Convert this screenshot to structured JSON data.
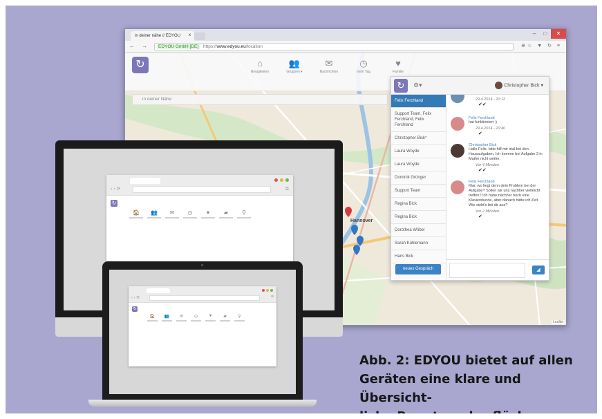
{
  "browser": {
    "tab_title": "in deiner nähe // EDYOU",
    "tab_close": "x",
    "certificate": "EDYOU GmbH [DE]",
    "url_prefix": "https://",
    "url_main": "www.edyou.eu",
    "url_path": "/location",
    "nav_glyphs": "← → C",
    "toolbar_glyphs": "⊕☆ ▼ ↻ ≡",
    "window_controls": [
      "–",
      "□",
      "✕"
    ]
  },
  "app": {
    "logo_glyph": "↻",
    "nav": [
      {
        "label": "Neuigkeiten",
        "icon": "⌂"
      },
      {
        "label": "Gruppen ▾",
        "icon": "👥"
      },
      {
        "label": "Nachrichten",
        "icon": "✉"
      },
      {
        "label": "mein Tag",
        "icon": "◷"
      },
      {
        "label": "Familie",
        "icon": "♥"
      }
    ],
    "breadcrumb": "in deiner Nähe",
    "map_label": "Hannover",
    "map_attribution": "Leaflet"
  },
  "chat": {
    "user_name": "Christopher Bick ▾",
    "gear": "⚙▾",
    "contacts": [
      "Felix Ferchland",
      "Support Team, Felix Ferchland, Felix Ferchland",
      "Christopher Bick*",
      "Laura Woyde",
      "Laura Woyde",
      "Dominik Grünger",
      "Support Team",
      "Regina Bick",
      "Regina Bick",
      "Dorothea Wöbel",
      "Sarah Kühlemann",
      "Hans Bick"
    ],
    "new_chat_button": "neues Gespräch",
    "send_icon": "◢",
    "messages": [
      {
        "name": "",
        "text": "",
        "time": "29.4.2014 - 20:12",
        "check": "✔✔",
        "avatar": "#6d8fb0"
      },
      {
        "name": "Felix Ferchland",
        "text": "hat funktioniert :)",
        "time": "29.4.2014 - 20:40",
        "check": "✔",
        "avatar": "#d88a8a"
      },
      {
        "name": "Christopher Bick",
        "text": "Hallo Felix, bitte hilf mir mal bei den Hausaufgaben. Ich komme bei Aufgabe 3 in Mathe nicht weiter.",
        "time": "Vor 4 Minuten",
        "check": "✔✔",
        "avatar": "#4b3a34"
      },
      {
        "name": "Felix Ferchland",
        "text": "Klar, wo liegt denn dein Problem bei der Aufgabe? Sollen wir uns nachher vielleicht treffen? Ich habe nachher noch eine Klavierstunde, aber danach hätte ich Zeit. Wie sieht's bei dir aus?",
        "time": "Vor 2 Minuten",
        "check": "✔",
        "avatar": "#d88a8a"
      }
    ]
  },
  "devices": {
    "mini_icons": [
      "🏠",
      "👥",
      "✉",
      "◷",
      "♥",
      "▰",
      "⚲"
    ],
    "mini_nav": "‹ › ⟳",
    "mini_menu": "≡",
    "mini_logo": "↻"
  },
  "caption": {
    "line1": "Abb. 2: EDYOU bietet auf allen",
    "line2": "Geräten eine klare und Übersicht-",
    "line3": "liche Benutzeroberfläche."
  }
}
